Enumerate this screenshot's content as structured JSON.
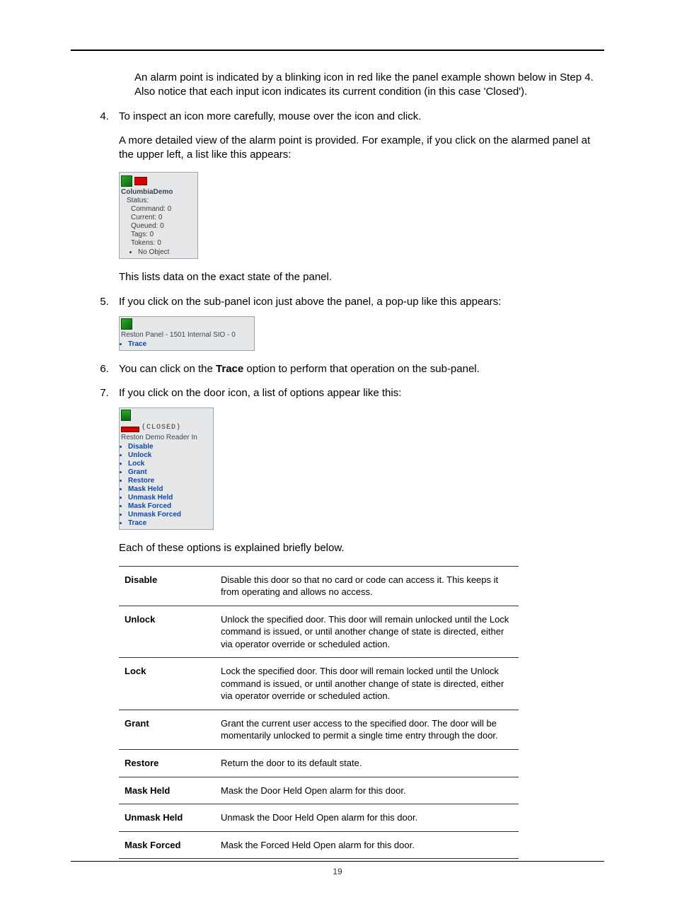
{
  "intro_para": "An alarm point is indicated by a blinking icon in red like the panel example shown below in Step 4. Also notice that each input icon indicates its current condition (in this case 'Closed').",
  "step4": {
    "text": "To inspect an icon more carefully, mouse over the icon and click.",
    "para": "A more detailed view of the alarm point is provided. For example, if you click on the alarmed panel at the upper left, a list like this appears:",
    "after": "This lists data on the exact state of the panel."
  },
  "fig1": {
    "title": "ColumbiaDemo",
    "status_label": "Status:",
    "lines": [
      "Command: 0",
      "Current: 0",
      "Queued: 0",
      "Tags: 0",
      "Tokens: 0"
    ],
    "bullet": "No Object"
  },
  "step5": {
    "text": "If you click on the sub-panel icon just above the panel, a pop-up like this appears:"
  },
  "fig2": {
    "title": "Reston Panel - 1501 Internal SIO - 0",
    "bullet": "Trace"
  },
  "step6": {
    "pre": "You can click on the ",
    "bold": "Trace",
    "post": " option to perform that operation on the sub-panel."
  },
  "step7": {
    "text": "If you click on the door icon, a list of options appear like this:",
    "after": "Each of these options is explained briefly below."
  },
  "fig3": {
    "closed": "(CLOSED)",
    "title": "Reston Demo Reader In",
    "items": [
      "Disable",
      "Unlock",
      "Lock",
      "Grant",
      "Restore",
      "Mask Held",
      "Unmask Held",
      "Mask Forced",
      "Unmask Forced",
      "Trace"
    ]
  },
  "table": [
    {
      "k": "Disable",
      "v": "Disable this door so that no card or code can access it. This keeps it from operating and allows no access."
    },
    {
      "k": "Unlock",
      "v": "Unlock the specified door. This door will remain unlocked until the Lock command is issued, or until another change of state is directed, either via operator override or scheduled action."
    },
    {
      "k": "Lock",
      "v": "Lock the specified door. This door will remain locked until the Unlock command is issued, or until another change of state is directed, either via operator override or scheduled action."
    },
    {
      "k": "Grant",
      "v": "Grant the current user access to the specified door. The door will be momentarily unlocked to permit a single time entry through the door."
    },
    {
      "k": "Restore",
      "v": "Return the door to its default state."
    },
    {
      "k": "Mask Held",
      "v": "Mask the Door Held Open alarm for this door."
    },
    {
      "k": "Unmask Held",
      "v": "Unmask the Door Held Open alarm for this door."
    },
    {
      "k": "Mask Forced",
      "v": "Mask the Forced Held Open alarm for this door."
    }
  ],
  "page_number": "19"
}
